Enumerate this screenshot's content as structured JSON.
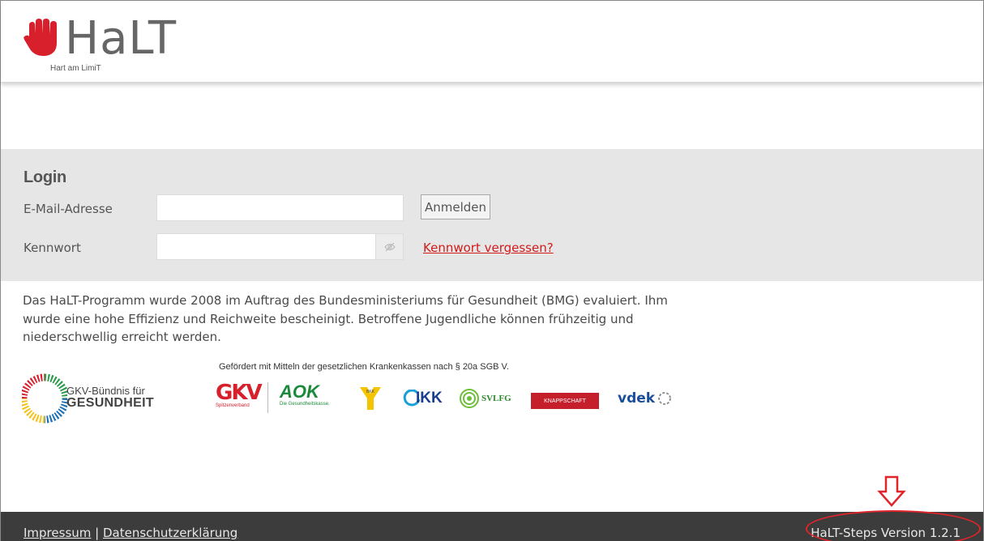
{
  "header": {
    "logo_title": "HaLT",
    "logo_subtitle": "Hart am LimiT"
  },
  "login": {
    "title": "Login",
    "email_label": "E-Mail-Adresse",
    "email_value": "",
    "password_label": "Kennwort",
    "password_value": "",
    "submit_label": "Anmelden",
    "forgot_label": "Kennwort vergessen?"
  },
  "info": {
    "text": "Das HaLT-Programm wurde 2008 im Auftrag des Bundesministeriums für Gesundheit (BMG) evaluiert. Ihm wurde eine hohe Effizienz und Reichweite bescheinigt. Betroffene Jugendliche können frühzeitig und niederschwellig erreicht werden."
  },
  "funding": {
    "text": "Gefördert mit Mitteln der gesetzlichen Krankenkassen nach § 20a SGB V.",
    "gkv_line1": "GKV-Bündnis für",
    "gkv_line2": "GESUNDHEIT",
    "partners": {
      "gkv": "GKV",
      "gkv_sub": "Spitzenverband",
      "aok": "AOK",
      "aok_sub": "Die Gesundheitskasse.",
      "bkk": "BKK",
      "ikk": "IKK",
      "svlfg": "SVLFG",
      "knappschaft": "KNAPPSCHAFT",
      "vdek": "vdek"
    }
  },
  "footer": {
    "impressum": "Impressum",
    "separator": "|",
    "privacy": "Datenschutzerklärung",
    "version": "HaLT-Steps Version 1.2.1"
  },
  "annotation": {
    "color": "#e0242a"
  }
}
